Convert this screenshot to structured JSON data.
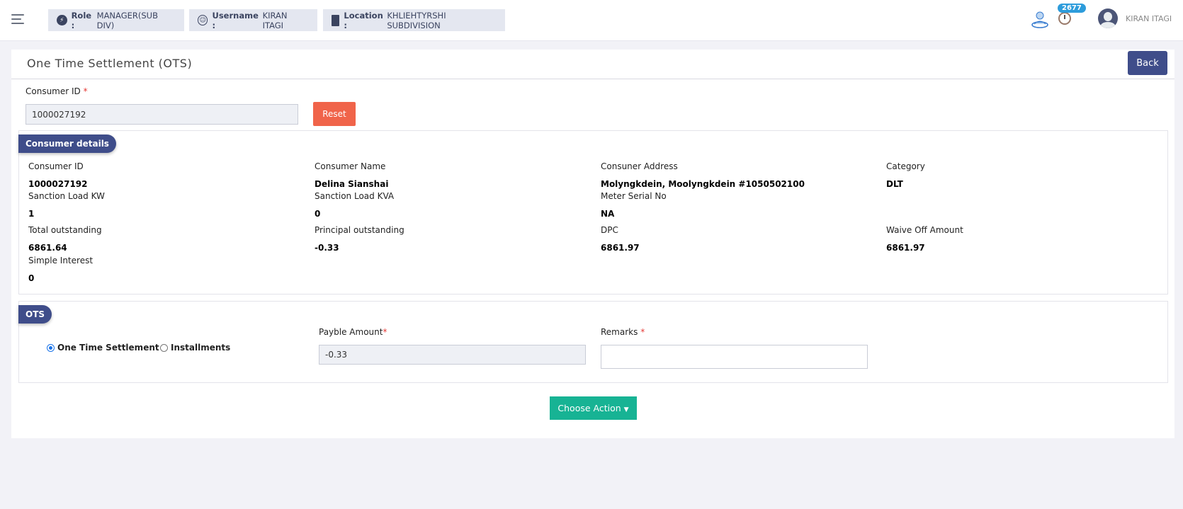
{
  "header": {
    "role_label": "Role :",
    "role_value": "MANAGER(SUB DIV)",
    "username_label": "Username :",
    "username_value": "KIRAN ITAGI",
    "location_label": "Location :",
    "location_value": "KHLIEHTYRSHI SUBDIVISION",
    "notification_count": "2677",
    "user_name": "KIRAN ITAGI"
  },
  "page": {
    "title": "One Time Settlement (OTS)",
    "back_label": "Back"
  },
  "search": {
    "consumer_id_label": "Consumer ID",
    "required_mark": "*",
    "consumer_id_value": "1000027192",
    "reset_label": "Reset"
  },
  "consumer_details": {
    "badge": "Consumer details",
    "fields": [
      {
        "label": "Consumer ID",
        "value": "1000027192"
      },
      {
        "label": "Consumer Name",
        "value": "Delina Sianshai"
      },
      {
        "label": "Consuner Address",
        "value": "Molyngkdein, Moolyngkdein #1050502100"
      },
      {
        "label": "Category",
        "value": "DLT"
      },
      {
        "label": "Sanction Load KW",
        "value": "1"
      },
      {
        "label": "Sanction Load KVA",
        "value": "0"
      },
      {
        "label": "Meter Serial No",
        "value": "NA"
      },
      {
        "label": "Total outstanding",
        "value": "6861.64"
      },
      {
        "label": "Principal outstanding",
        "value": "-0.33"
      },
      {
        "label": "DPC",
        "value": "6861.97"
      },
      {
        "label": "Waive Off Amount",
        "value": "6861.97"
      },
      {
        "label": "Simple Interest",
        "value": "0"
      }
    ]
  },
  "ots": {
    "badge": "OTS",
    "option_ots": "One Time Settlement",
    "option_installments": "Installments",
    "selected": "One Time Settlement",
    "payable_label": "Payble Amount",
    "payable_value": "-0.33",
    "remarks_label": "Remarks",
    "remarks_value": "",
    "required_mark": "*"
  },
  "actions": {
    "choose_label": "Choose Action"
  },
  "colors": {
    "primary": "#3f4d8a",
    "reset": "#f0644a",
    "action": "#17b394",
    "badge_blue": "#2d9cdb"
  }
}
